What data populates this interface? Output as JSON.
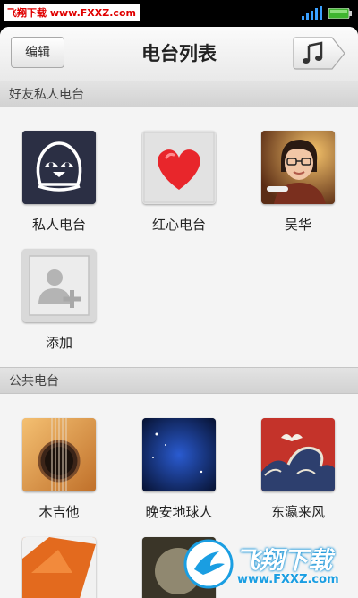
{
  "status_bar": {
    "watermark": "飞翔下载 www.FXXZ.com"
  },
  "header": {
    "edit_label": "编辑",
    "title": "电台列表",
    "music_icon": "music-note-icon"
  },
  "sections": [
    {
      "title": "好友私人电台",
      "items": [
        {
          "label": "私人电台",
          "icon": "penguin-icon"
        },
        {
          "label": "红心电台",
          "icon": "heart-icon"
        },
        {
          "label": "吴华",
          "icon": "avatar-photo"
        },
        {
          "label": "添加",
          "icon": "add-person-icon"
        }
      ]
    },
    {
      "title": "公共电台",
      "items": [
        {
          "label": "木吉他",
          "icon": "guitar-icon"
        },
        {
          "label": "晚安地球人",
          "icon": "moon-night-icon"
        },
        {
          "label": "东瀛来风",
          "icon": "wave-art-icon"
        }
      ]
    }
  ],
  "watermark_bottom": {
    "big": "飞翔下载",
    "small": "www.FXXZ.com"
  },
  "colors": {
    "accent_watermark": "#1a9ee2",
    "heart": "#e8262b",
    "penguin_bg": "#2b2f44"
  }
}
